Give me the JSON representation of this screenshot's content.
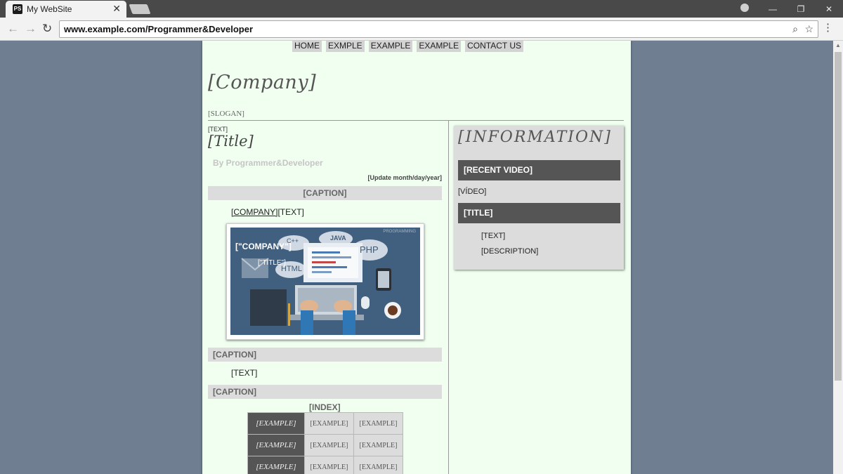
{
  "browser": {
    "tab_title": "My WebSite",
    "tab_favicon": "PS",
    "url": "www.example.com/Programmer&Developer"
  },
  "site": {
    "nav": [
      "HOME",
      "EXMPLE",
      "EXAMPLE",
      "EXAMPLE",
      "CONTACT US"
    ],
    "company": "[Company]",
    "slogan": "[SLOGAN]"
  },
  "post": {
    "small_text": "[TEXT]",
    "title": "[Title]",
    "byline": "By Programmer&Developer",
    "update": "[Update month/day/year]",
    "caption1": "[CAPTION]",
    "company_link": "[COMPANY]",
    "company_text": "[TEXT]",
    "figure": {
      "company": "[\"COMPANY\"]",
      "title": "[\"TITLE\"]",
      "programming": "PROGRAMMING",
      "java": "JAVA",
      "php": "PHP",
      "cpp": "C++",
      "html": "HTML"
    },
    "caption2": "[CAPTION]",
    "text2": "[TEXT]",
    "caption3": "[CAPTION]",
    "index_title": "[INDEX]",
    "index_rows": [
      [
        "[EXAMPLE]",
        "[EXAMPLE]",
        "[EXAMPLE]"
      ],
      [
        "[EXAMPLE]",
        "[EXAMPLE]",
        "[EXAMPLE]"
      ],
      [
        "[EXAMPLE]",
        "[EXAMPLE]",
        "[EXAMPLE]"
      ]
    ]
  },
  "sidebar": {
    "heading": "[INFORMATION]",
    "recent_video": "[RECENT VIDEO]",
    "video": "[VÍDEO]",
    "title": "[TITLE]",
    "text": "[TEXT]",
    "description": "[DESCRIPTION]"
  },
  "colors": {
    "page_bg": "#f0fff0",
    "outer_bg": "#6f7f91",
    "bar_dark": "#555555",
    "bar_light": "#dcdcdc"
  }
}
